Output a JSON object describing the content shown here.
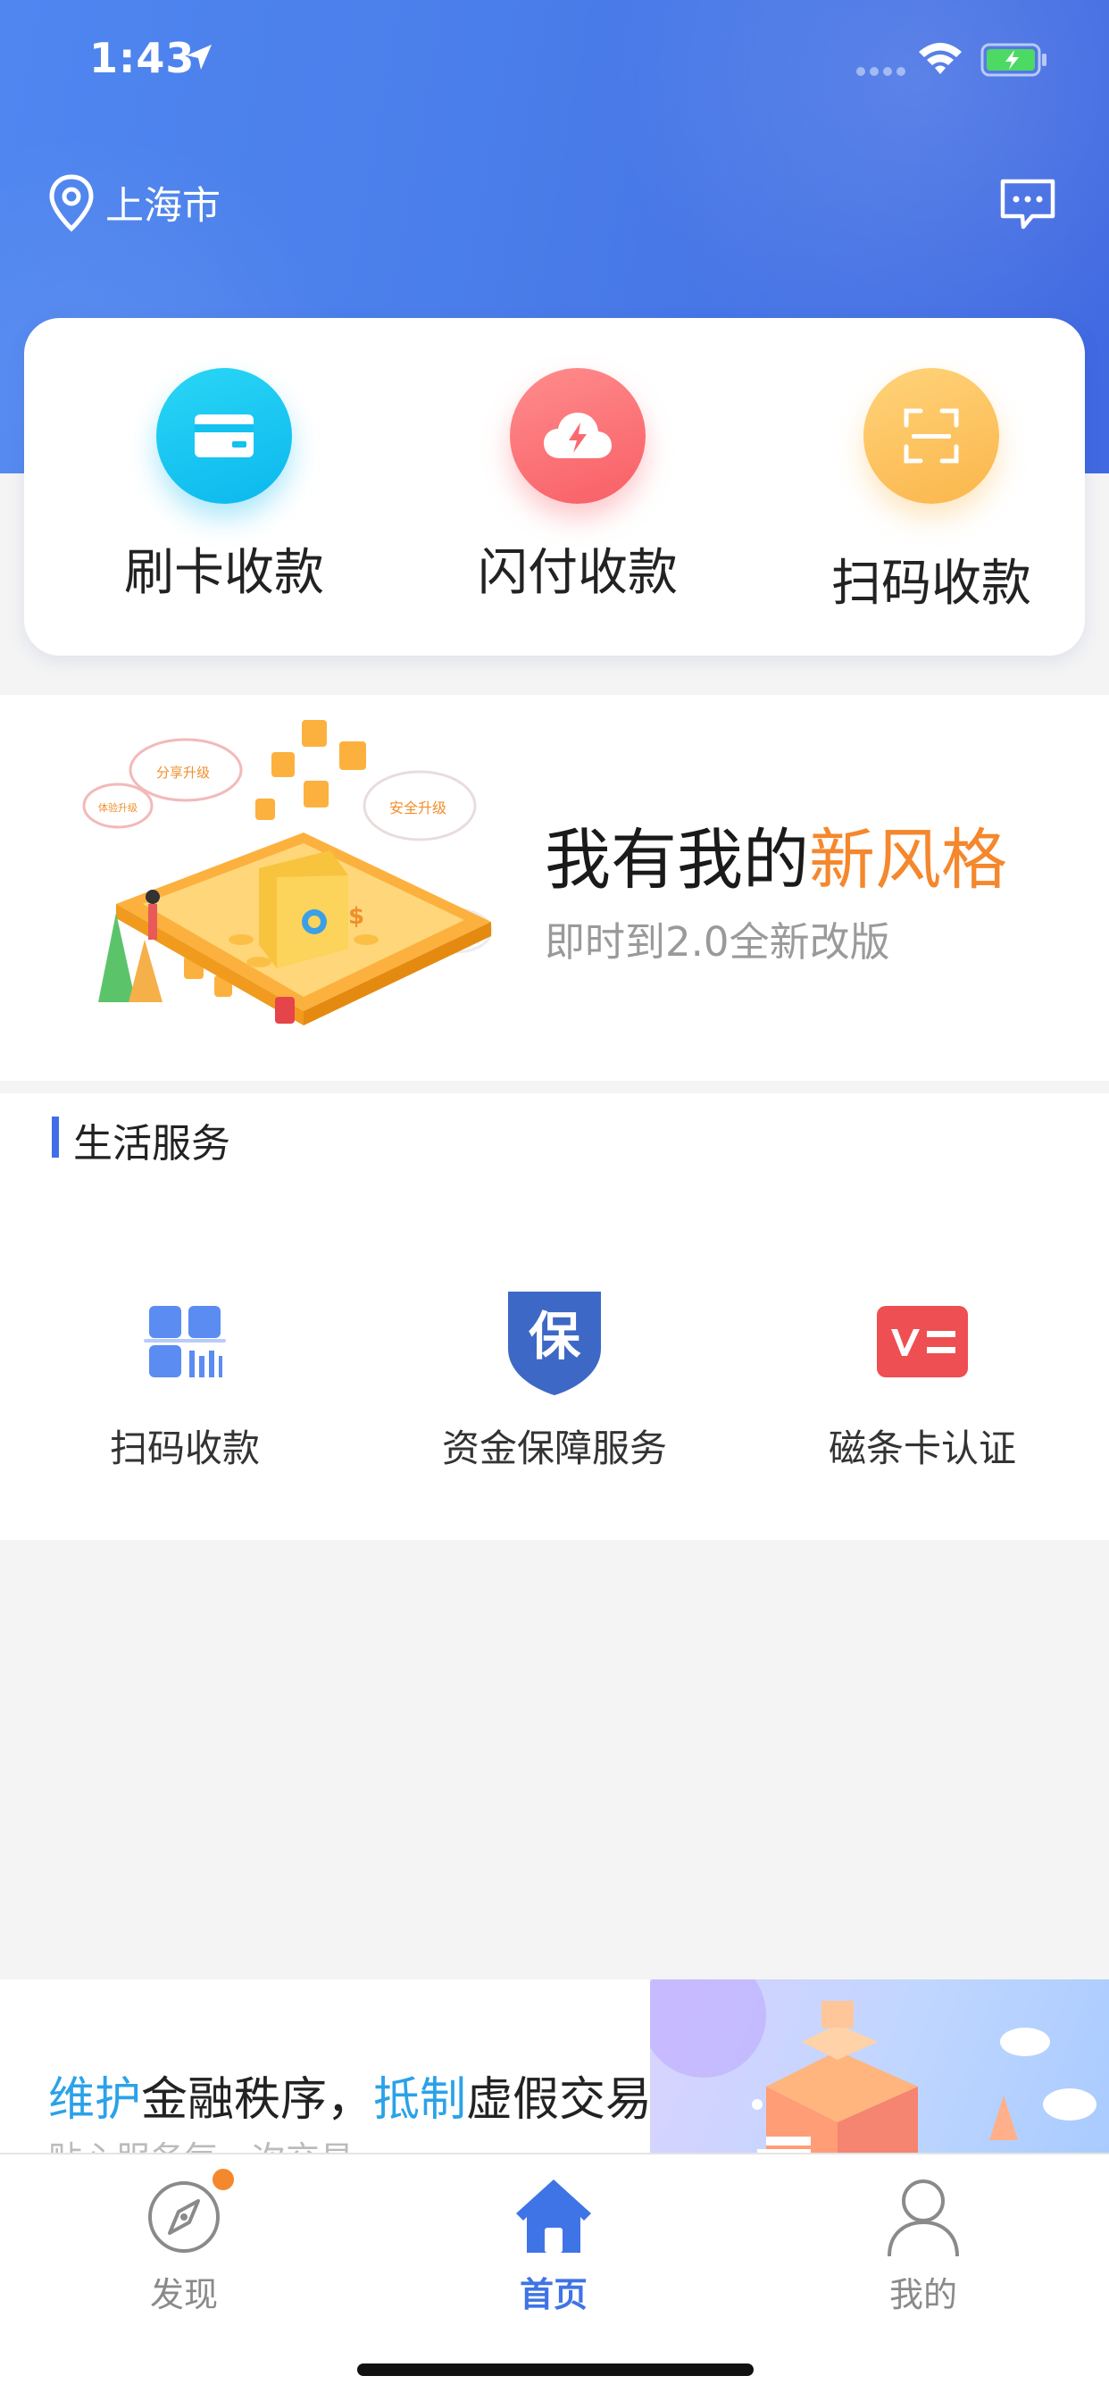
{
  "status_bar": {
    "time": "1:43"
  },
  "header": {
    "city": "上海市"
  },
  "quick_actions": [
    {
      "label": "刷卡收款",
      "icon": "card-icon",
      "color": "#12c6f1"
    },
    {
      "label": "闪付收款",
      "icon": "cloud-flash-icon",
      "color": "#fa6e73"
    },
    {
      "label": "扫码收款",
      "icon": "scan-icon",
      "color": "#fcbf57"
    }
  ],
  "banner": {
    "headline_plain": "我有我的",
    "headline_highlight": "新风格",
    "subtitle": "即时到2.0全新改版",
    "art_labels": [
      "分享升级",
      "安全升级",
      "体验升级"
    ]
  },
  "services": {
    "section_title": "生活服务",
    "items": [
      {
        "label": "扫码收款",
        "icon": "qr-code-icon"
      },
      {
        "label": "资金保障服务",
        "icon": "shield-bao-icon",
        "glyph": "保"
      },
      {
        "label": "磁条卡认证",
        "icon": "v-card-icon"
      }
    ]
  },
  "promo": {
    "part1_blue": "维护",
    "part2": "金融秩序，",
    "part3_blue": "抵制",
    "part4": "虚假交易",
    "subtitle": "贴心服务每一次交易"
  },
  "tabbar": {
    "tabs": [
      {
        "label": "发现",
        "icon": "compass-icon",
        "active": false
      },
      {
        "label": "首页",
        "icon": "home-icon",
        "active": true
      },
      {
        "label": "我的",
        "icon": "user-icon",
        "active": false
      }
    ]
  },
  "colors": {
    "primary": "#4a7de9",
    "accent_orange": "#f5872c",
    "accent_blue_text": "#2ba2e8",
    "tab_active": "#3f74e6"
  }
}
